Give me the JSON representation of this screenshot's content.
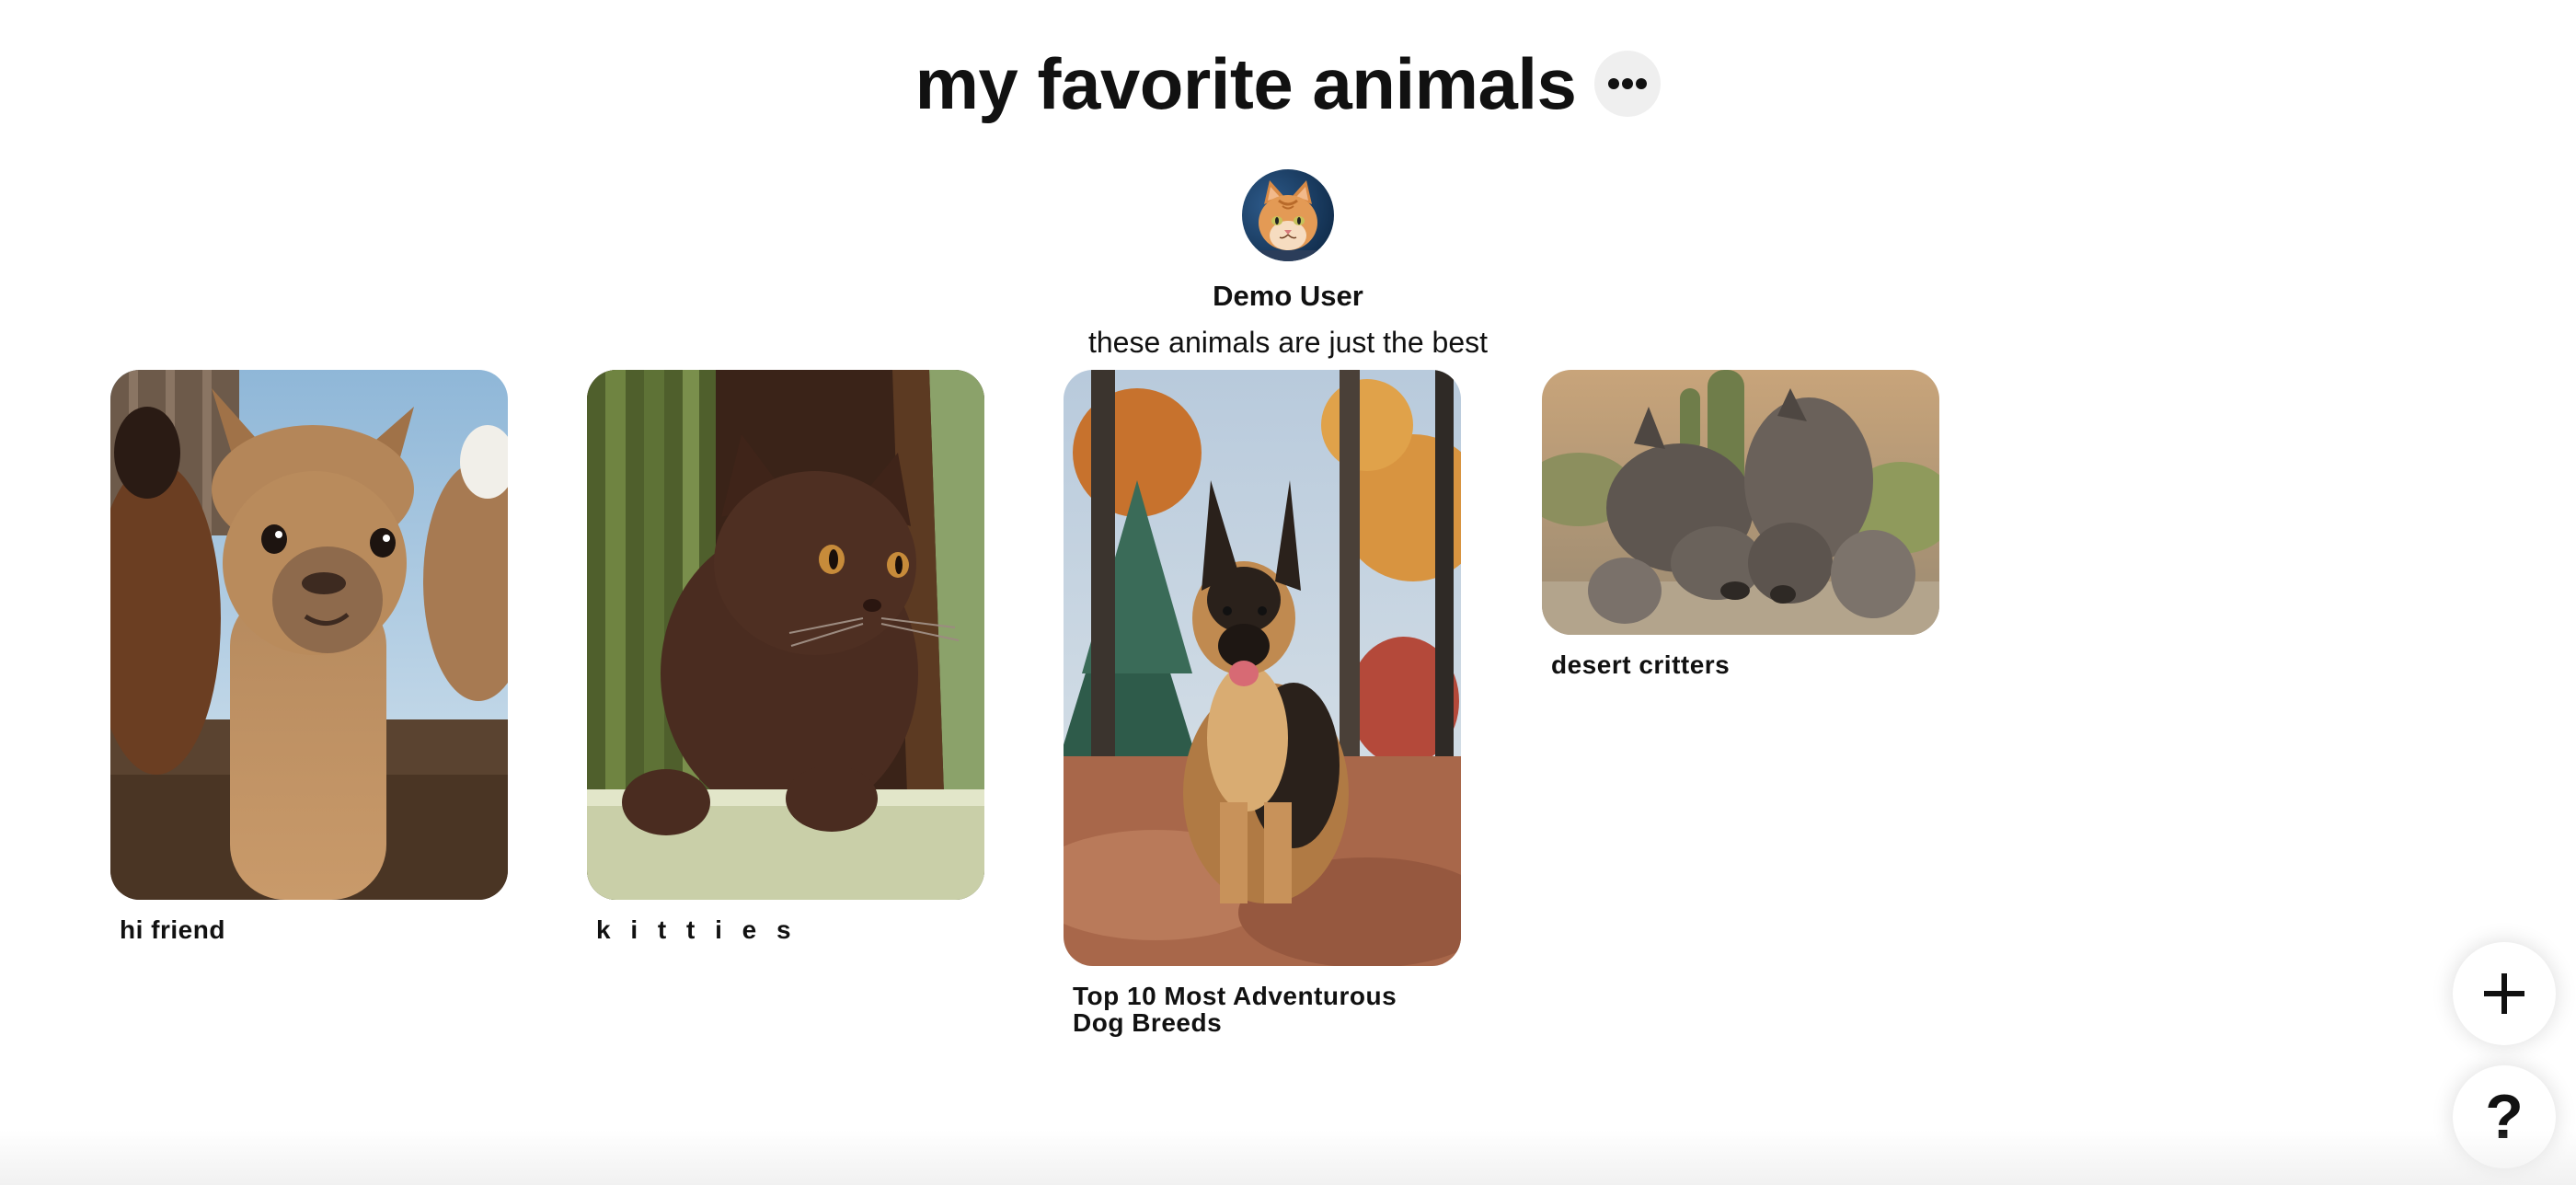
{
  "board": {
    "title": "my favorite animals",
    "owner_name": "Demo User",
    "description": "these animals are just the best"
  },
  "header_icons": {
    "more": "ellipsis-icon",
    "avatar": "cat-avatar-image"
  },
  "pins": [
    {
      "title": "hi friend",
      "image": "alpaca-photo"
    },
    {
      "title": "k i t t i e s",
      "image": "brown-kitten-photo"
    },
    {
      "title": "Top 10 Most Adventurous Dog Breeds",
      "image": "german-shepherd-photo"
    },
    {
      "title": "desert critters",
      "image": "javelinas-photo"
    }
  ],
  "floating_buttons": {
    "add": "plus-icon",
    "help": "?"
  },
  "colors": {
    "background": "#ffffff",
    "text": "#111111",
    "button_gray": "#efefef"
  }
}
